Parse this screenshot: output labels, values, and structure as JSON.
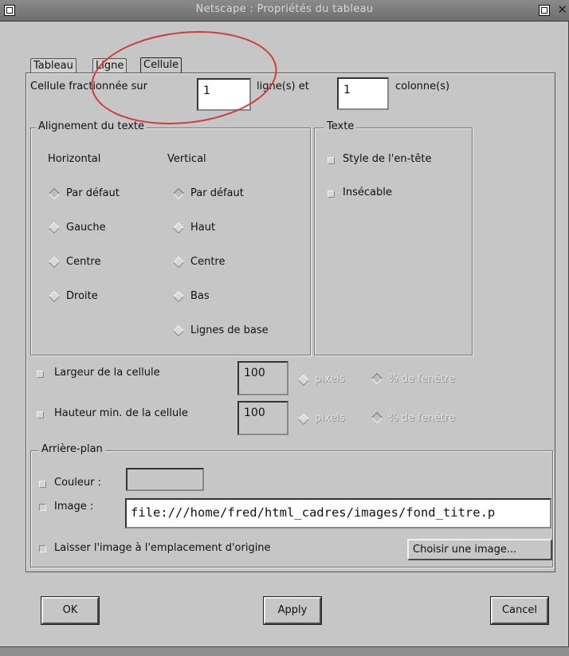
{
  "window": {
    "title": "Netscape : Propriétés du tableau",
    "close_glyph": "✕"
  },
  "tabs": [
    {
      "label": "Tableau"
    },
    {
      "label": "Ligne"
    },
    {
      "label": "Cellule"
    }
  ],
  "span": {
    "prefix": "Cellule fractionnée sur",
    "rows_value": "1",
    "rows_suffix": "ligne(s) et",
    "cols_value": "1",
    "cols_suffix": "colonne(s)"
  },
  "alignment": {
    "title": "Alignement du texte",
    "horizontal_heading": "Horizontal",
    "vertical_heading": "Vertical",
    "horizontal_options": [
      "Par défaut",
      "Gauche",
      "Centre",
      "Droite"
    ],
    "vertical_options": [
      "Par défaut",
      "Haut",
      "Centre",
      "Bas",
      "Lignes de base"
    ]
  },
  "text_group": {
    "title": "Texte",
    "header_style": "Style de l'en-tête",
    "nowrap": "Insécable"
  },
  "width": {
    "label": "Largeur de la cellule",
    "value": "100",
    "unit_pixels": "pixels",
    "unit_percent": "% de fenêtre"
  },
  "height": {
    "label": "Hauteur min. de la cellule",
    "value": "100",
    "unit_pixels": "pixels",
    "unit_percent": "% de fenêtre"
  },
  "background": {
    "title": "Arrière-plan",
    "color_label": "Couleur :",
    "image_label": "Image :",
    "image_value": "file:///home/fred/html_cadres/images/fond_titre.p",
    "keep_label": "Laisser l'image à l'emplacement d'origine",
    "choose_button": "Choisir une image..."
  },
  "buttons": {
    "ok": "OK",
    "apply": "Apply",
    "cancel": "Cancel"
  },
  "colors": {
    "dialog_bg": "#c6c6c6",
    "annotation": "#d13a3a"
  }
}
